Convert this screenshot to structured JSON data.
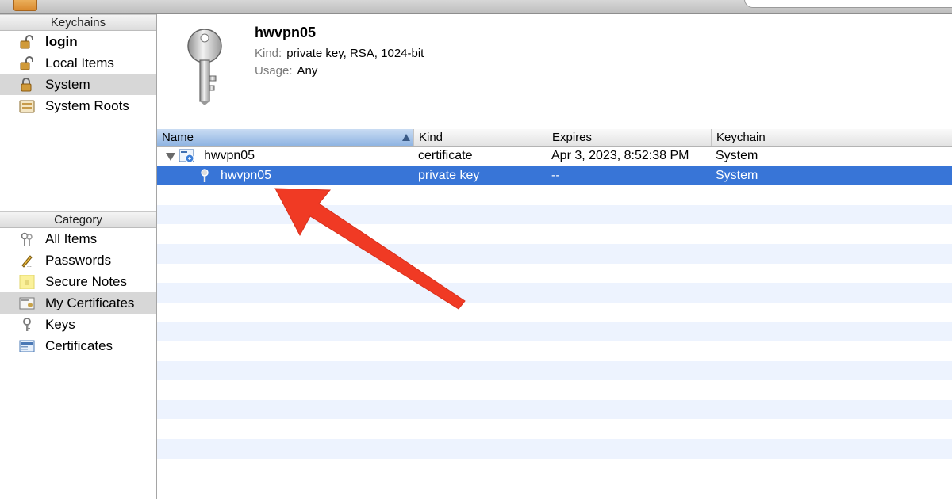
{
  "sidebar": {
    "keychains_header": "Keychains",
    "keychains": [
      {
        "label": "login",
        "icon": "unlocked-padlock-icon",
        "bold": true
      },
      {
        "label": "Local Items",
        "icon": "unlocked-padlock-icon"
      },
      {
        "label": "System",
        "icon": "locked-padlock-icon",
        "selected": true
      },
      {
        "label": "System Roots",
        "icon": "certificate-cabinet-icon"
      }
    ],
    "category_header": "Category",
    "categories": [
      {
        "label": "All Items",
        "icon": "keys-icon"
      },
      {
        "label": "Passwords",
        "icon": "pen-password-icon"
      },
      {
        "label": "Secure Notes",
        "icon": "note-icon"
      },
      {
        "label": "My Certificates",
        "icon": "my-certificate-icon",
        "selected": true
      },
      {
        "label": "Keys",
        "icon": "key-icon"
      },
      {
        "label": "Certificates",
        "icon": "certificate-icon"
      }
    ]
  },
  "detail": {
    "title": "hwvpn05",
    "kind_label": "Kind:",
    "kind_value": "private key, RSA, 1024-bit",
    "usage_label": "Usage:",
    "usage_value": "Any",
    "icon": "large-key-icon"
  },
  "table": {
    "columns": [
      "Name",
      "Kind",
      "Expires",
      "Keychain"
    ],
    "sorted_column": "Name",
    "rows": [
      {
        "name": "hwvpn05",
        "kind": "certificate",
        "expires": "Apr 3, 2023, 8:52:38 PM",
        "keychain": "System",
        "icon": "certificate-icon",
        "expanded": true
      },
      {
        "name": "hwvpn05",
        "kind": "private key",
        "expires": "--",
        "keychain": "System",
        "icon": "key-icon",
        "selected": true
      }
    ]
  },
  "colors": {
    "selection": "#3875d7",
    "annotation_arrow": "#f03a24",
    "row_stripe": "#edf3fe"
  }
}
